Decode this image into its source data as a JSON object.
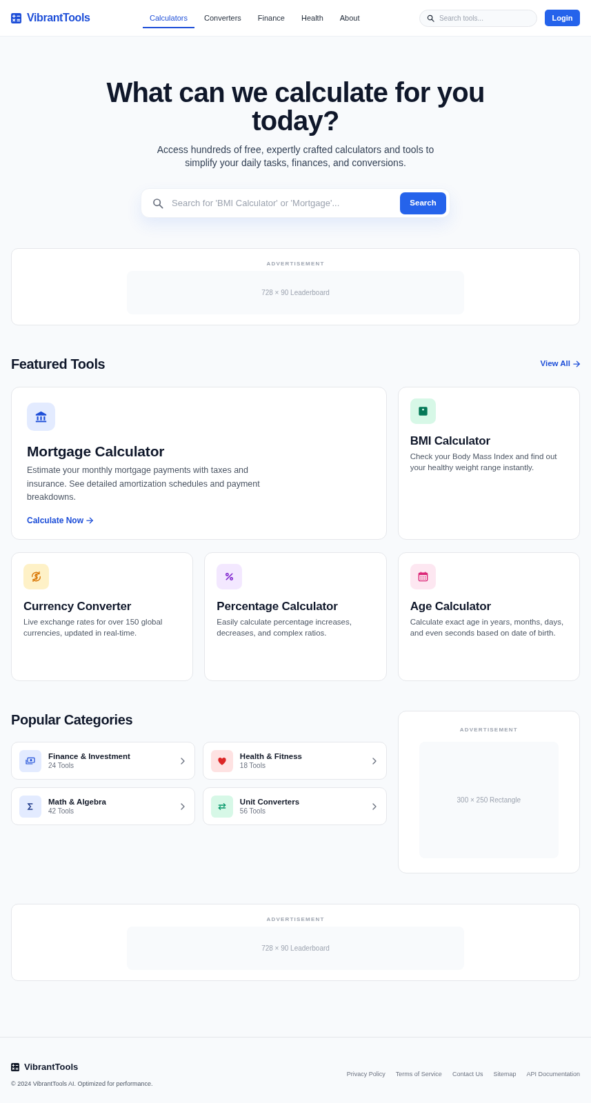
{
  "header": {
    "brand": "VibrantTools",
    "nav": [
      {
        "label": "Calculators",
        "selected": true
      },
      {
        "label": "Converters",
        "selected": false
      },
      {
        "label": "Finance",
        "selected": false
      },
      {
        "label": "Health",
        "selected": false
      },
      {
        "label": "About",
        "selected": false
      }
    ],
    "search": {
      "placeholder": "Search tools..."
    },
    "login": "Login"
  },
  "hero": {
    "title": "What can we calculate for you today?",
    "subtitle": "Access hundreds of free, expertly crafted calculators and tools to simplify your daily tasks, finances, and conversions.",
    "search": {
      "placeholder": "Search for 'BMI Calculator' or 'Mortgage'...",
      "button": "Search"
    }
  },
  "ad_top": {
    "label": "ADVERTISEMENT",
    "slot": "728 × 90 Leaderboard"
  },
  "featured": {
    "heading": "Featured Tools",
    "view_all": "View All",
    "cards": [
      {
        "kind": "bank",
        "title": "Mortgage Calculator",
        "description": "Estimate your monthly mortgage payments with taxes and insurance. See detailed amortization schedules and payment breakdowns.",
        "link": "Calculate Now"
      },
      {
        "kind": "scale",
        "title": "BMI Calculator",
        "description": "Check your Body Mass Index and find out your healthy weight range instantly."
      },
      {
        "kind": "currency",
        "title": "Currency Converter",
        "description": "Live exchange rates for over 150 global currencies, updated in real-time."
      },
      {
        "kind": "percent",
        "title": "Percentage Calculator",
        "description": "Easily calculate percentage increases, decreases, and complex ratios."
      },
      {
        "kind": "calendar",
        "title": "Age Calculator",
        "description": "Calculate exact age in years, months, days, and even seconds based on date of birth."
      }
    ]
  },
  "categories": {
    "heading": "Popular Categories",
    "items": [
      {
        "kind": "money",
        "name": "Finance & Investment",
        "count": "24 Tools"
      },
      {
        "kind": "heart",
        "name": "Health & Fitness",
        "count": "18 Tools"
      },
      {
        "kind": "sigma",
        "name": "Math & Algebra",
        "count": "42 Tools"
      },
      {
        "kind": "swap",
        "name": "Unit Converters",
        "count": "56 Tools"
      }
    ]
  },
  "ad_side": {
    "label": "ADVERTISEMENT",
    "slot": "300 × 250 Rectangle"
  },
  "ad_bottom": {
    "label": "ADVERTISEMENT",
    "slot": "728 × 90 Leaderboard"
  },
  "footer": {
    "brand": "VibrantTools",
    "copyright": "© 2024 VibrantTools AI. Optimized for performance.",
    "links": [
      "Privacy Policy",
      "Terms of Service",
      "Contact Us",
      "Sitemap",
      "API Documentation"
    ]
  }
}
